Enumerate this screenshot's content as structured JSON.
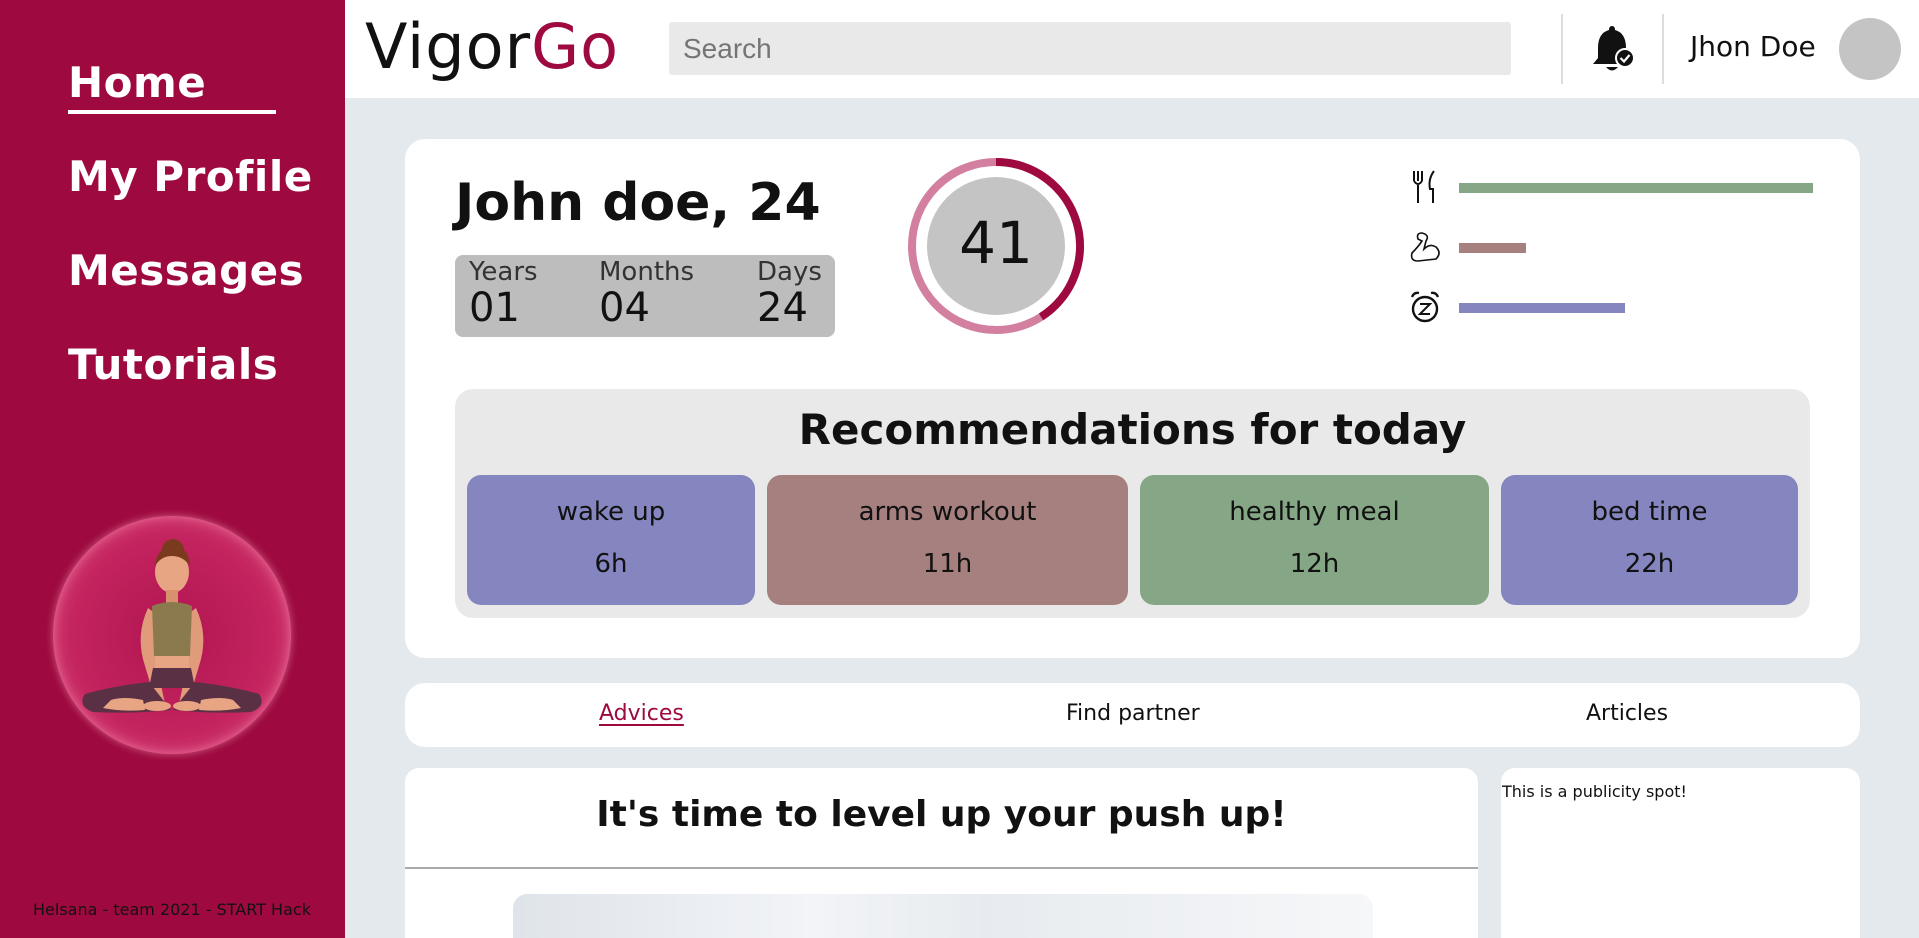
{
  "sidebar": {
    "nav": [
      "Home",
      "My Profile",
      "Messages",
      "Tutorials"
    ],
    "footer": "Helsana - team 2021 - START Hack"
  },
  "header": {
    "logo_part1": "Vigor",
    "logo_part2": "Go",
    "search_placeholder": "Search",
    "username": "Jhon Doe"
  },
  "profile": {
    "name": "John doe, 24",
    "age": [
      {
        "label": "Years",
        "value": "01"
      },
      {
        "label": "Months",
        "value": "04"
      },
      {
        "label": "Days",
        "value": "24"
      }
    ],
    "score": "41",
    "score_fraction": 0.41,
    "bars": [
      {
        "icon": "fork-knife-icon",
        "fraction": 1.0,
        "color": "#86a786"
      },
      {
        "icon": "muscle-arm-icon",
        "fraction": 0.19,
        "color": "#a6807f"
      },
      {
        "icon": "alarm-clock-icon",
        "fraction": 0.47,
        "color": "#8585bf"
      }
    ]
  },
  "recommendations": {
    "title": "Recommendations for today",
    "items": [
      {
        "title": "wake up",
        "time": "6h",
        "color": "#8585bf"
      },
      {
        "title": "arms workout",
        "time": "11h",
        "color": "#a6807f"
      },
      {
        "title": "healthy meal",
        "time": "12h",
        "color": "#86a786"
      },
      {
        "title": "bed time",
        "time": "22h",
        "color": "#8585bf"
      }
    ]
  },
  "tabs": [
    "Advices",
    "Find partner",
    "Articles"
  ],
  "content": {
    "title": "It's time to level up your push up!"
  },
  "ad": {
    "text": "This is a publicity spot!"
  },
  "colors": {
    "brand": "#9e0a40",
    "gauge_light": "#d27fa0",
    "gauge_dark": "#9e0a40"
  }
}
